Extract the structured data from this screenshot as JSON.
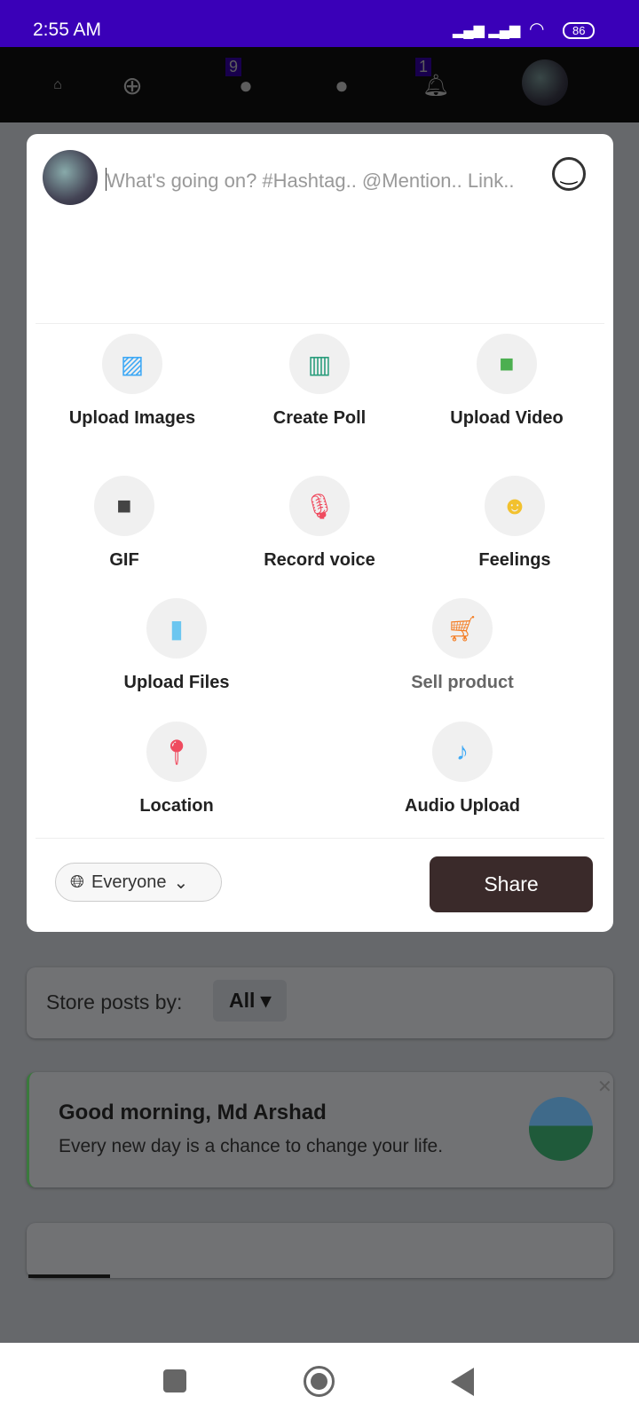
{
  "status_bar": {
    "time": "2:55 AM",
    "battery": "86"
  },
  "top_nav": {
    "friends_badge": "9",
    "notifications_badge": "1"
  },
  "composer": {
    "placeholder": "What's going on? #Hashtag.. @Mention.. Link..",
    "actions": [
      {
        "label": "Upload Images",
        "icon": "image-icon",
        "color": "#3fa9f5"
      },
      {
        "label": "Create Poll",
        "icon": "poll-icon",
        "color": "#2a9d7c"
      },
      {
        "label": "Upload Video",
        "icon": "video-icon",
        "color": "#4caf50"
      },
      {
        "label": "GIF",
        "icon": "briefcase-icon",
        "color": "#444444"
      },
      {
        "label": "Record voice",
        "icon": "microphone-icon",
        "color": "#ef4b5f"
      },
      {
        "label": "Feelings",
        "icon": "smiley-icon",
        "color": "#f2c12e"
      },
      {
        "label": "Upload Files",
        "icon": "file-icon",
        "color": "#6cc6f0"
      },
      {
        "label": "Sell product",
        "icon": "cart-icon",
        "color": "#f47b20"
      },
      {
        "label": "Location",
        "icon": "location-pin-icon",
        "color": "#ef4b5f"
      },
      {
        "label": "Audio Upload",
        "icon": "music-note-icon",
        "color": "#3fa9f5"
      }
    ],
    "privacy": "Everyone",
    "share": "Share"
  },
  "feed": {
    "store_label": "Store posts by:",
    "store_value": "All",
    "greeting_title": "Good morning, Md Arshad",
    "greeting_text": "Every new day is a chance to change your life."
  }
}
